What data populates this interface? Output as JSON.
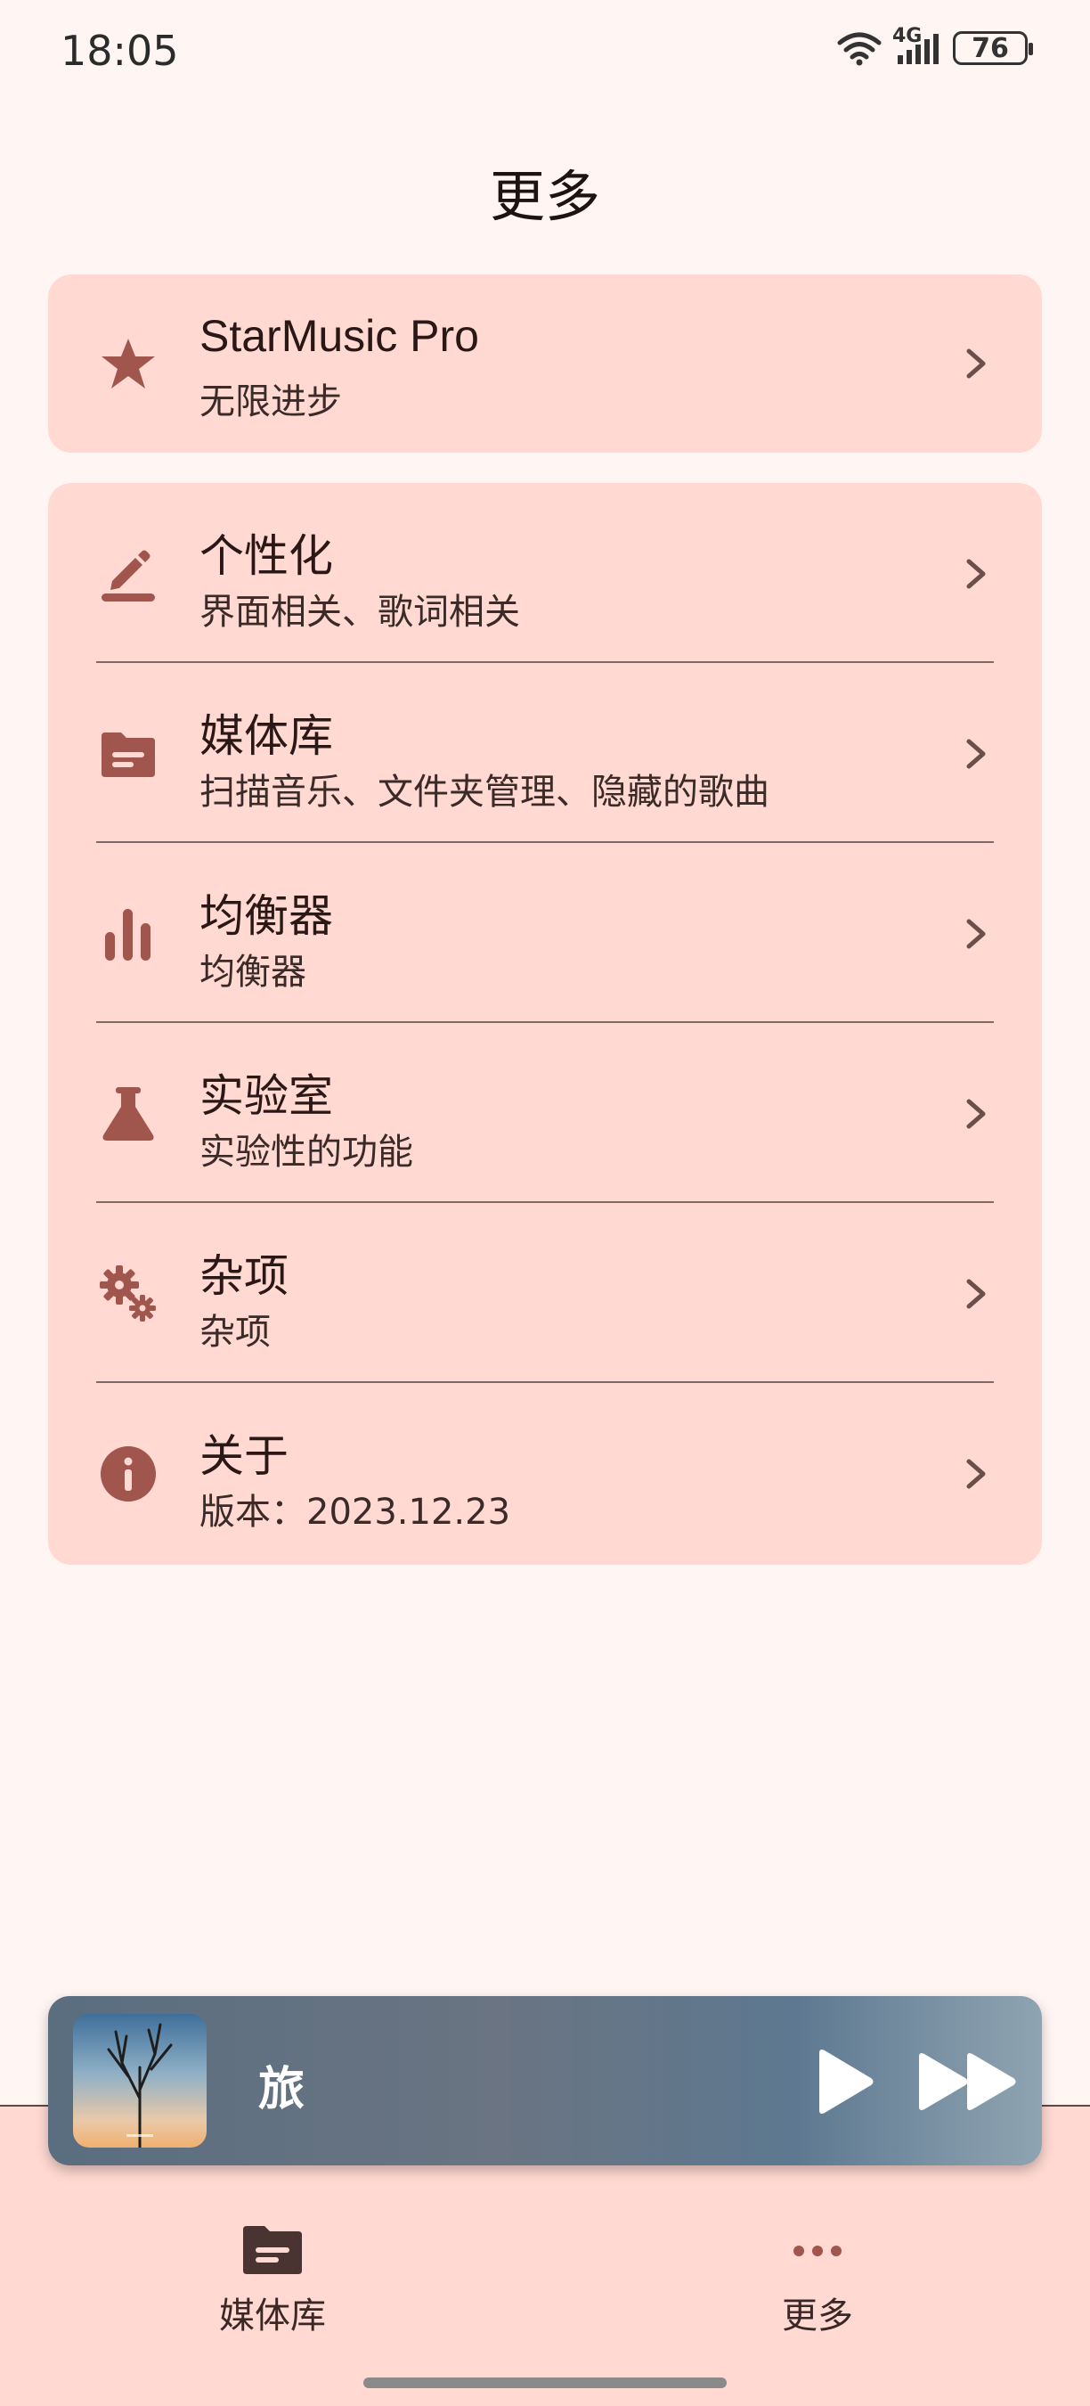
{
  "status_bar": {
    "time": "18:05",
    "network": "4G",
    "battery": "76"
  },
  "header": {
    "title": "更多"
  },
  "pro_card": {
    "title": "StarMusic Pro",
    "subtitle": "无限进步",
    "icon": "star-icon"
  },
  "settings": [
    {
      "title": "个性化",
      "subtitle": "界面相关、歌词相关",
      "icon": "edit-icon"
    },
    {
      "title": "媒体库",
      "subtitle": "扫描音乐、文件夹管理、隐藏的歌曲",
      "icon": "folder-icon"
    },
    {
      "title": "均衡器",
      "subtitle": "均衡器",
      "icon": "equalizer-icon"
    },
    {
      "title": "实验室",
      "subtitle": "实验性的功能",
      "icon": "flask-icon"
    },
    {
      "title": "杂项",
      "subtitle": "杂项",
      "icon": "gears-icon"
    },
    {
      "title": "关于",
      "subtitle": "版本：2023.12.23",
      "icon": "info-icon"
    }
  ],
  "player": {
    "song_title": "旅"
  },
  "bottom_nav": {
    "library_label": "媒体库",
    "more_label": "更多"
  },
  "colors": {
    "accent": "#a0554d",
    "card_bg": "#ffd9d2",
    "page_bg": "#fff5f3"
  }
}
